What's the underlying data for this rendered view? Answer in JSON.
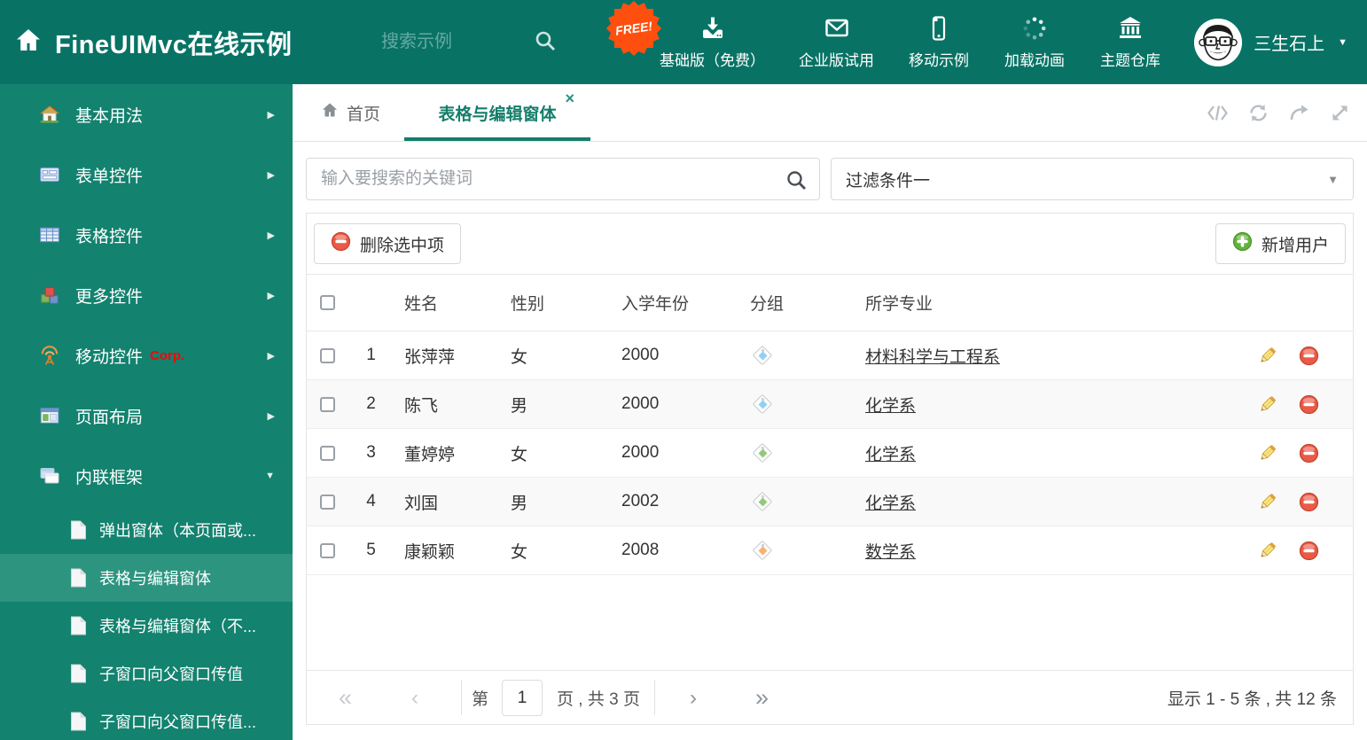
{
  "colors": {
    "header_bg": "#087365",
    "sidebar_bg": "#13826F",
    "sidebar_active_bg": "#2D9480",
    "accent_teal": "#147e6b",
    "free_badge_orange": "#ff4f0f",
    "corp_red": "#ff0000",
    "delete_red": "#ea5a45",
    "add_green": "#62b33c"
  },
  "header": {
    "title": "FineUIMvc在线示例",
    "search_placeholder": "搜索示例",
    "free_badge": "FREE!",
    "nav_items": [
      {
        "label": "基础版（免费）",
        "icon": "download-icon"
      },
      {
        "label": "企业版试用",
        "icon": "envelope-icon"
      },
      {
        "label": "移动示例",
        "icon": "mobile-icon"
      },
      {
        "label": "加载动画",
        "icon": "spinner-icon"
      },
      {
        "label": "主题仓库",
        "icon": "bank-icon"
      }
    ],
    "user_name": "三生石上"
  },
  "sidebar": {
    "items": [
      {
        "label": "基本用法",
        "icon": "home-color-icon",
        "arrow": "▶"
      },
      {
        "label": "表单控件",
        "icon": "form-icon",
        "arrow": "▶"
      },
      {
        "label": "表格控件",
        "icon": "table-icon",
        "arrow": "▶"
      },
      {
        "label": "更多控件",
        "icon": "cubes-icon",
        "arrow": "▶"
      },
      {
        "label": "移动控件",
        "badge": "Corp.",
        "icon": "antenna-icon",
        "arrow": "▶"
      },
      {
        "label": "页面布局",
        "icon": "layout-icon",
        "arrow": "▶"
      },
      {
        "label": "内联框架",
        "icon": "frames-icon",
        "arrow": "▼"
      }
    ],
    "subitems": [
      {
        "label": "弹出窗体（本页面或...",
        "icon": "file-icon"
      },
      {
        "label": "表格与编辑窗体",
        "icon": "file-icon",
        "active": true
      },
      {
        "label": "表格与编辑窗体（不...",
        "icon": "file-icon"
      },
      {
        "label": "子窗口向父窗口传值",
        "icon": "file-icon"
      },
      {
        "label": "子窗口向父窗口传值...",
        "icon": "file-icon"
      }
    ]
  },
  "tabs": [
    {
      "label": "首页"
    },
    {
      "label": "表格与编辑窗体",
      "close": "×",
      "active": true
    }
  ],
  "filters": {
    "search_placeholder": "输入要搜索的关键词",
    "filter_value": "过滤条件一"
  },
  "grid_toolbar": {
    "delete_label": "删除选中项",
    "add_label": "新增用户"
  },
  "table": {
    "headers": {
      "name": "姓名",
      "gender": "性别",
      "year": "入学年份",
      "group": "分组",
      "major": "所学专业"
    },
    "rows": [
      {
        "index": "1",
        "name": "张萍萍",
        "gender": "女",
        "year": "2000",
        "tag_color": "#8fd0f5",
        "major": "材料科学与工程系"
      },
      {
        "index": "2",
        "name": "陈飞",
        "gender": "男",
        "year": "2000",
        "tag_color": "#8fd0f5",
        "major": "化学系"
      },
      {
        "index": "3",
        "name": "董婷婷",
        "gender": "女",
        "year": "2000",
        "tag_color": "#95c87c",
        "major": "化学系"
      },
      {
        "index": "4",
        "name": "刘国",
        "gender": "男",
        "year": "2002",
        "tag_color": "#95c87c",
        "major": "化学系"
      },
      {
        "index": "5",
        "name": "康颖颖",
        "gender": "女",
        "year": "2008",
        "tag_color": "#f6b26f",
        "major": "数学系"
      }
    ]
  },
  "pagination": {
    "first": "«",
    "prev": "‹",
    "next": "›",
    "last": "»",
    "page_prefix": "第",
    "page_value": "1",
    "page_suffix": "页 , 共 3 页",
    "summary": "显示 1 - 5 条 , 共 12 条"
  }
}
